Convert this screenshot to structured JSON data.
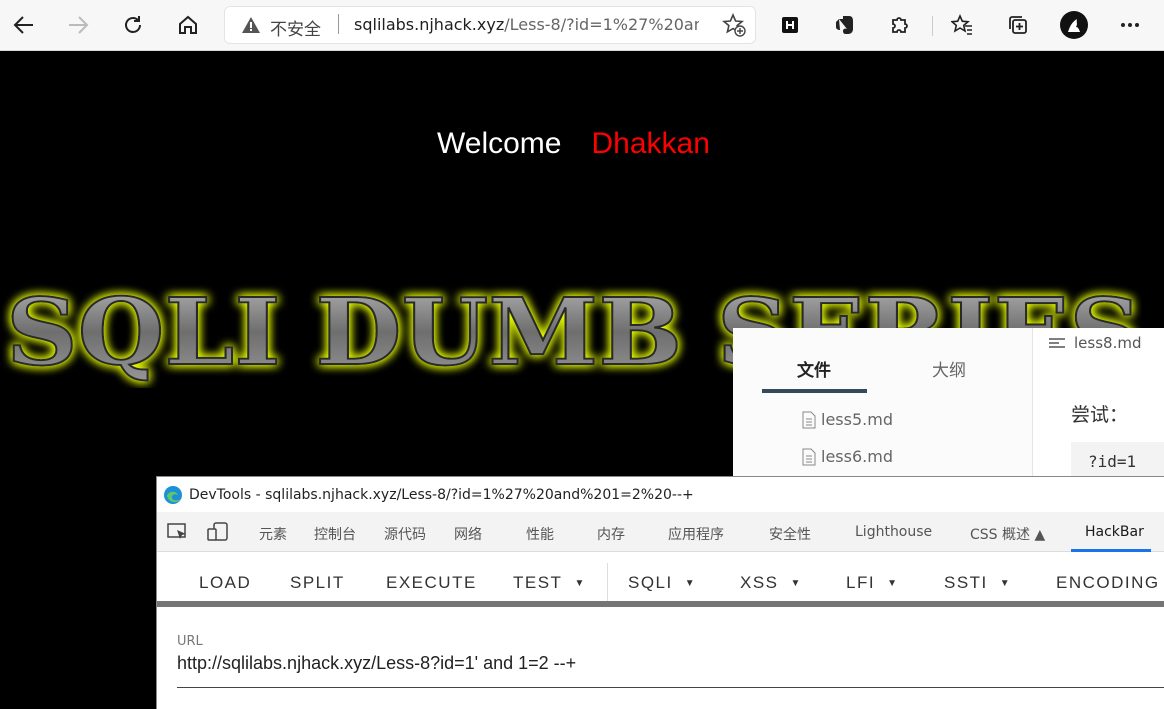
{
  "browser": {
    "security_label": "不安全",
    "url_host": "sqlilabs.njhack.xyz",
    "url_path": "/Less-8/?id=1%27%20an..."
  },
  "page": {
    "welcome": "Welcome",
    "name": "Dhakkan",
    "banner": "SQLI DUMB SERIES",
    "colors": {
      "name": "#ff0000",
      "banner_glow": "#e8ff00"
    }
  },
  "editor": {
    "tabs": [
      "文件",
      "大纲"
    ],
    "files": [
      "less5.md",
      "less6.md"
    ],
    "current_file": "less8.md",
    "heading": "尝试：",
    "code": "?id=1"
  },
  "devtools": {
    "title": "DevTools - sqlilabs.njhack.xyz/Less-8/?id=1%27%20and%201=2%20--+",
    "tabs": [
      "元素",
      "控制台",
      "源代码",
      "网络",
      "性能",
      "内存",
      "应用程序",
      "安全性",
      "Lighthouse",
      "CSS 概述 ▲",
      "HackBar"
    ],
    "active_tab": "HackBar",
    "accent": "#1a73e8"
  },
  "hackbar": {
    "load": "LOAD",
    "split": "SPLIT",
    "execute": "EXECUTE",
    "test": "TEST",
    "sqli": "SQLI",
    "xss": "XSS",
    "lfi": "LFI",
    "ssti": "SSTI",
    "encoding": "ENCODING",
    "url_label": "URL",
    "url_value": "http://sqlilabs.njhack.xyz/Less-8?id=1' and 1=2 --+"
  }
}
